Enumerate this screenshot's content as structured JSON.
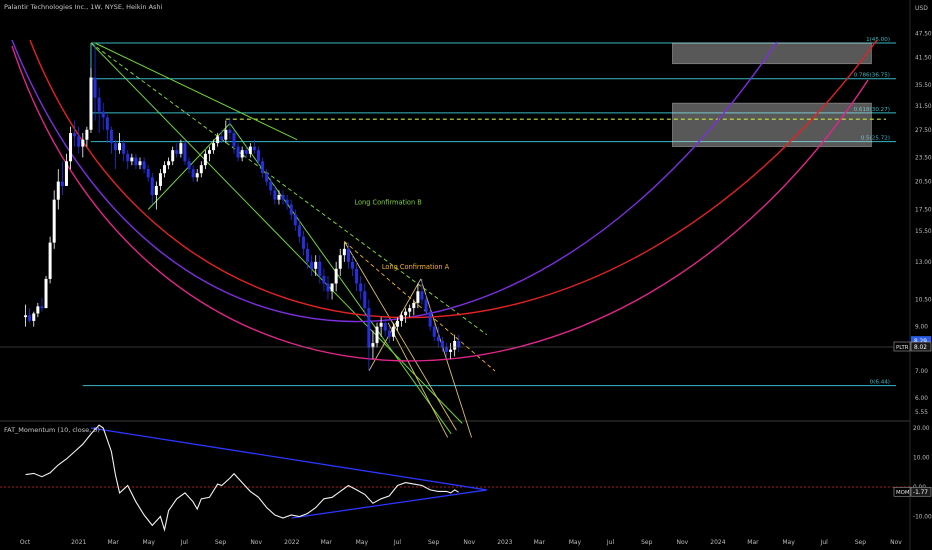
{
  "header": {
    "symbol_line": "Palantir Technologies Inc., 1W, NYSE, Heikin Ashi",
    "currency": "USD"
  },
  "indicator": {
    "title": "FAT_Momentum (10, close, 0)",
    "tag": "MOM",
    "value": "-1.77"
  },
  "price_tag": {
    "symbol": "PLTR",
    "value": "8.02",
    "prev_value": "8.29"
  },
  "chart_data": {
    "type": "candlestick",
    "y_scale": "log",
    "y_ticks": [
      "47.50",
      "41.50",
      "35.50",
      "31.50",
      "27.50",
      "23.50",
      "20.50",
      "17.50",
      "15.50",
      "13.00",
      "10.50",
      "9.00",
      "7.00",
      "6.00",
      "5.55"
    ],
    "indicator_ticks": [
      "20.00",
      "10.00",
      "0.00",
      "-10.00"
    ],
    "x_ticks": [
      {
        "label": "Oct",
        "date": "2020-10-01"
      },
      {
        "label": "2021",
        "date": "2021-01-01"
      },
      {
        "label": "Mar",
        "date": "2021-03-01"
      },
      {
        "label": "May",
        "date": "2021-05-01"
      },
      {
        "label": "Jul",
        "date": "2021-07-01"
      },
      {
        "label": "Sep",
        "date": "2021-09-01"
      },
      {
        "label": "Nov",
        "date": "2021-11-01"
      },
      {
        "label": "2022",
        "date": "2022-01-01"
      },
      {
        "label": "Mar",
        "date": "2022-03-01"
      },
      {
        "label": "May",
        "date": "2022-05-01"
      },
      {
        "label": "Jul",
        "date": "2022-07-01"
      },
      {
        "label": "Sep",
        "date": "2022-09-01"
      },
      {
        "label": "Nov",
        "date": "2022-11-01"
      },
      {
        "label": "2023",
        "date": "2023-01-01"
      },
      {
        "label": "Mar",
        "date": "2023-03-01"
      },
      {
        "label": "May",
        "date": "2023-05-01"
      },
      {
        "label": "Jul",
        "date": "2023-07-01"
      },
      {
        "label": "Sep",
        "date": "2023-09-01"
      },
      {
        "label": "Nov",
        "date": "2023-11-01"
      },
      {
        "label": "2024",
        "date": "2024-01-01"
      },
      {
        "label": "Mar",
        "date": "2024-03-01"
      },
      {
        "label": "May",
        "date": "2024-05-01"
      },
      {
        "label": "Jul",
        "date": "2024-07-01"
      },
      {
        "label": "Sep",
        "date": "2024-09-01"
      },
      {
        "label": "Nov",
        "date": "2024-11-01"
      }
    ],
    "fib_levels": [
      {
        "label": "1(45.00)",
        "value": 45.0
      },
      {
        "label": "0.786(36.75)",
        "value": 36.75
      },
      {
        "label": "0.618(30.27)",
        "value": 30.27
      },
      {
        "label": "0.5(25.72)",
        "value": 25.72
      },
      {
        "label": "0(6.44)",
        "value": 6.44
      }
    ],
    "annotations": [
      {
        "text": "Long Confirmation B",
        "date": "2022-06-15",
        "price": 18.0,
        "color": "#7cd234"
      },
      {
        "text": "Long Confirmation A",
        "date": "2022-08-01",
        "price": 12.5,
        "color": "#f5b323"
      }
    ],
    "zones": [
      {
        "date_from": "2023-10-15",
        "date_to": "2024-09-20",
        "price_from": 40.0,
        "price_to": 45.0
      },
      {
        "date_from": "2023-10-15",
        "date_to": "2024-09-20",
        "price_from": 25.0,
        "price_to": 32.0
      }
    ],
    "candles": [
      [
        "2020-10-02",
        9.5,
        10.2,
        9.0,
        9.6
      ],
      [
        "2020-10-09",
        9.6,
        10.0,
        9.2,
        9.3
      ],
      [
        "2020-10-16",
        9.3,
        9.8,
        9.0,
        9.7
      ],
      [
        "2020-10-23",
        9.7,
        10.3,
        9.5,
        10.1
      ],
      [
        "2020-10-30",
        10.1,
        10.6,
        9.8,
        10.0
      ],
      [
        "2020-11-06",
        10.0,
        12.0,
        10.0,
        11.8
      ],
      [
        "2020-11-13",
        11.8,
        15.0,
        11.5,
        14.5
      ],
      [
        "2020-11-20",
        14.5,
        19.5,
        14.0,
        18.5
      ],
      [
        "2020-11-27",
        18.5,
        22.0,
        17.5,
        20.5
      ],
      [
        "2020-12-04",
        20.5,
        23.0,
        19.0,
        20.0
      ],
      [
        "2020-12-11",
        20.0,
        24.0,
        20.0,
        23.0
      ],
      [
        "2020-12-18",
        23.0,
        28.0,
        22.0,
        27.0
      ],
      [
        "2020-12-25",
        27.0,
        29.0,
        25.0,
        26.5
      ],
      [
        "2021-01-01",
        26.5,
        28.0,
        24.0,
        25.0
      ],
      [
        "2021-01-08",
        25.0,
        27.0,
        23.5,
        26.0
      ],
      [
        "2021-01-15",
        26.0,
        28.0,
        25.0,
        27.5
      ],
      [
        "2021-01-22",
        27.5,
        39.0,
        27.0,
        37.0
      ],
      [
        "2021-01-29",
        37.0,
        45.0,
        29.0,
        33.0
      ],
      [
        "2021-02-05",
        33.0,
        35.0,
        27.0,
        30.5
      ],
      [
        "2021-02-12",
        30.5,
        32.0,
        27.5,
        29.5
      ],
      [
        "2021-02-19",
        29.5,
        30.0,
        25.5,
        27.5
      ],
      [
        "2021-02-26",
        27.5,
        28.0,
        24.0,
        25.5
      ],
      [
        "2021-03-05",
        25.5,
        26.0,
        22.0,
        24.5
      ],
      [
        "2021-03-12",
        24.5,
        27.0,
        24.0,
        25.5
      ],
      [
        "2021-03-19",
        25.5,
        26.0,
        23.0,
        24.0
      ],
      [
        "2021-03-26",
        24.0,
        24.5,
        22.0,
        23.0
      ],
      [
        "2021-04-02",
        23.0,
        24.0,
        22.5,
        23.5
      ],
      [
        "2021-04-09",
        23.5,
        24.0,
        22.0,
        22.5
      ],
      [
        "2021-04-16",
        22.5,
        23.5,
        22.0,
        23.0
      ],
      [
        "2021-04-23",
        23.0,
        23.5,
        21.5,
        22.0
      ],
      [
        "2021-04-30",
        22.0,
        22.5,
        20.5,
        21.0
      ],
      [
        "2021-05-07",
        21.0,
        21.5,
        18.0,
        19.0
      ],
      [
        "2021-05-14",
        19.0,
        20.5,
        17.5,
        20.0
      ],
      [
        "2021-05-21",
        20.0,
        22.0,
        19.5,
        21.5
      ],
      [
        "2021-05-28",
        21.5,
        23.0,
        21.0,
        22.5
      ],
      [
        "2021-06-04",
        22.5,
        23.5,
        22.0,
        23.0
      ],
      [
        "2021-06-11",
        23.0,
        25.0,
        22.5,
        24.5
      ],
      [
        "2021-06-18",
        24.5,
        25.5,
        23.5,
        24.0
      ],
      [
        "2021-06-25",
        24.0,
        26.0,
        23.5,
        25.5
      ],
      [
        "2021-07-02",
        25.5,
        26.0,
        22.5,
        23.0
      ],
      [
        "2021-07-09",
        23.0,
        23.5,
        21.5,
        22.0
      ],
      [
        "2021-07-16",
        22.0,
        22.5,
        20.5,
        21.0
      ],
      [
        "2021-07-23",
        21.0,
        22.0,
        20.5,
        21.5
      ],
      [
        "2021-07-30",
        21.5,
        23.0,
        21.0,
        22.5
      ],
      [
        "2021-08-06",
        22.5,
        24.5,
        22.0,
        24.0
      ],
      [
        "2021-08-13",
        24.0,
        25.0,
        23.0,
        24.5
      ],
      [
        "2021-08-20",
        24.5,
        26.0,
        24.0,
        25.5
      ],
      [
        "2021-08-27",
        25.5,
        27.0,
        25.0,
        26.5
      ],
      [
        "2021-09-03",
        26.5,
        27.5,
        25.5,
        26.0
      ],
      [
        "2021-09-10",
        26.0,
        29.0,
        25.5,
        27.5
      ],
      [
        "2021-09-17",
        27.5,
        29.5,
        26.0,
        27.0
      ],
      [
        "2021-09-24",
        27.0,
        27.5,
        24.0,
        25.0
      ],
      [
        "2021-10-01",
        25.0,
        25.5,
        23.0,
        23.5
      ],
      [
        "2021-10-08",
        23.5,
        25.0,
        23.0,
        24.5
      ],
      [
        "2021-10-15",
        24.5,
        25.0,
        23.5,
        24.0
      ],
      [
        "2021-10-22",
        24.0,
        25.5,
        23.5,
        25.0
      ],
      [
        "2021-10-29",
        25.0,
        26.0,
        24.0,
        24.5
      ],
      [
        "2021-11-05",
        24.5,
        25.0,
        22.5,
        23.0
      ],
      [
        "2021-11-12",
        23.0,
        23.5,
        21.0,
        21.5
      ],
      [
        "2021-11-19",
        21.5,
        22.0,
        20.0,
        20.5
      ],
      [
        "2021-11-26",
        20.5,
        21.0,
        19.0,
        19.5
      ],
      [
        "2021-12-03",
        19.5,
        20.0,
        18.0,
        18.5
      ],
      [
        "2021-12-10",
        18.5,
        19.5,
        18.0,
        19.0
      ],
      [
        "2021-12-17",
        19.0,
        19.5,
        18.0,
        18.5
      ],
      [
        "2021-12-24",
        18.5,
        19.0,
        17.5,
        18.0
      ],
      [
        "2021-12-31",
        18.0,
        18.5,
        16.5,
        17.0
      ],
      [
        "2022-01-07",
        17.0,
        17.5,
        15.5,
        16.0
      ],
      [
        "2022-01-14",
        16.0,
        16.5,
        14.5,
        15.0
      ],
      [
        "2022-01-21",
        15.0,
        15.5,
        13.5,
        14.0
      ],
      [
        "2022-01-28",
        14.0,
        14.5,
        12.5,
        13.0
      ],
      [
        "2022-02-04",
        13.0,
        13.5,
        12.0,
        12.5
      ],
      [
        "2022-02-11",
        12.5,
        13.5,
        12.0,
        13.0
      ],
      [
        "2022-02-18",
        13.0,
        13.5,
        11.5,
        12.0
      ],
      [
        "2022-02-25",
        12.0,
        12.5,
        11.0,
        11.5
      ],
      [
        "2022-03-04",
        11.5,
        12.0,
        10.5,
        11.0
      ],
      [
        "2022-03-11",
        11.0,
        11.5,
        10.5,
        11.5
      ],
      [
        "2022-03-18",
        11.5,
        13.0,
        11.0,
        12.5
      ],
      [
        "2022-03-25",
        12.5,
        14.0,
        12.0,
        13.5
      ],
      [
        "2022-04-01",
        13.5,
        14.5,
        13.0,
        14.0
      ],
      [
        "2022-04-08",
        14.0,
        14.5,
        12.5,
        13.0
      ],
      [
        "2022-04-15",
        13.0,
        13.5,
        12.0,
        12.5
      ],
      [
        "2022-04-22",
        12.5,
        13.0,
        11.0,
        11.5
      ],
      [
        "2022-04-29",
        11.5,
        12.0,
        10.5,
        11.0
      ],
      [
        "2022-05-06",
        11.0,
        11.5,
        9.5,
        10.0
      ],
      [
        "2022-05-13",
        10.0,
        10.5,
        7.0,
        8.0
      ],
      [
        "2022-05-20",
        8.0,
        8.8,
        7.5,
        8.2
      ],
      [
        "2022-05-27",
        8.2,
        9.2,
        8.0,
        9.0
      ],
      [
        "2022-06-03",
        9.0,
        9.5,
        8.5,
        9.2
      ],
      [
        "2022-06-10",
        9.2,
        9.5,
        8.5,
        8.8
      ],
      [
        "2022-06-17",
        8.8,
        9.0,
        8.2,
        8.5
      ],
      [
        "2022-06-24",
        8.5,
        9.2,
        8.3,
        9.0
      ],
      [
        "2022-07-01",
        9.0,
        9.5,
        8.8,
        9.3
      ],
      [
        "2022-07-08",
        9.3,
        9.8,
        9.0,
        9.6
      ],
      [
        "2022-07-15",
        9.6,
        10.0,
        9.2,
        9.8
      ],
      [
        "2022-07-22",
        9.8,
        10.2,
        9.5,
        10.0
      ],
      [
        "2022-07-29",
        10.0,
        10.5,
        9.6,
        10.3
      ],
      [
        "2022-08-05",
        10.3,
        11.5,
        10.0,
        11.0
      ],
      [
        "2022-08-12",
        11.0,
        11.8,
        10.2,
        10.5
      ],
      [
        "2022-08-19",
        10.5,
        10.8,
        9.5,
        9.8
      ],
      [
        "2022-08-26",
        9.8,
        10.0,
        8.8,
        9.0
      ],
      [
        "2022-09-02",
        9.0,
        9.2,
        8.3,
        8.5
      ],
      [
        "2022-09-09",
        8.5,
        9.0,
        8.0,
        8.3
      ],
      [
        "2022-09-16",
        8.3,
        8.5,
        7.8,
        8.0
      ],
      [
        "2022-09-23",
        8.0,
        8.2,
        7.6,
        7.8
      ],
      [
        "2022-09-30",
        7.8,
        8.2,
        7.5,
        7.9
      ],
      [
        "2022-10-07",
        7.9,
        8.6,
        7.6,
        8.3
      ],
      [
        "2022-10-14",
        8.3,
        8.6,
        7.8,
        8.02
      ]
    ],
    "momentum": [
      [
        "2020-10-02",
        4.2
      ],
      [
        "2020-10-16",
        4.6
      ],
      [
        "2020-10-30",
        3.5
      ],
      [
        "2020-11-13",
        4.8
      ],
      [
        "2020-11-27",
        7.5
      ],
      [
        "2020-12-11",
        9.5
      ],
      [
        "2020-12-25",
        12.0
      ],
      [
        "2021-01-08",
        14.5
      ],
      [
        "2021-01-22",
        18.0
      ],
      [
        "2021-02-05",
        21.0
      ],
      [
        "2021-02-12",
        20.0
      ],
      [
        "2021-02-26",
        12.0
      ],
      [
        "2021-03-05",
        4.0
      ],
      [
        "2021-03-12",
        -2.0
      ],
      [
        "2021-03-26",
        0.5
      ],
      [
        "2021-04-09",
        -5.0
      ],
      [
        "2021-04-23",
        -9.5
      ],
      [
        "2021-05-07",
        -13.0
      ],
      [
        "2021-05-21",
        -10.0
      ],
      [
        "2021-05-28",
        -14.5
      ],
      [
        "2021-06-04",
        -8.0
      ],
      [
        "2021-06-18",
        -4.0
      ],
      [
        "2021-07-02",
        -2.0
      ],
      [
        "2021-07-16",
        -5.0
      ],
      [
        "2021-07-23",
        -7.5
      ],
      [
        "2021-07-30",
        -4.0
      ],
      [
        "2021-08-13",
        -3.5
      ],
      [
        "2021-08-27",
        1.0
      ],
      [
        "2021-09-03",
        0.5
      ],
      [
        "2021-09-17",
        3.0
      ],
      [
        "2021-09-24",
        4.5
      ],
      [
        "2021-10-08",
        1.5
      ],
      [
        "2021-10-22",
        -1.5
      ],
      [
        "2021-11-05",
        -3.5
      ],
      [
        "2021-11-19",
        -7.0
      ],
      [
        "2021-12-03",
        -9.5
      ],
      [
        "2021-12-17",
        -10.5
      ],
      [
        "2021-12-31",
        -9.5
      ],
      [
        "2022-01-14",
        -10.0
      ],
      [
        "2022-01-28",
        -9.0
      ],
      [
        "2022-02-11",
        -7.0
      ],
      [
        "2022-02-25",
        -4.0
      ],
      [
        "2022-03-11",
        -3.5
      ],
      [
        "2022-03-25",
        -1.5
      ],
      [
        "2022-04-08",
        0.5
      ],
      [
        "2022-04-22",
        -1.0
      ],
      [
        "2022-05-06",
        -2.5
      ],
      [
        "2022-05-20",
        -5.5
      ],
      [
        "2022-06-03",
        -4.0
      ],
      [
        "2022-06-17",
        -3.0
      ],
      [
        "2022-07-01",
        0.5
      ],
      [
        "2022-07-15",
        1.5
      ],
      [
        "2022-07-29",
        1.0
      ],
      [
        "2022-08-12",
        0.5
      ],
      [
        "2022-08-26",
        -1.0
      ],
      [
        "2022-09-09",
        -1.5
      ],
      [
        "2022-09-23",
        -1.5
      ],
      [
        "2022-09-30",
        -2.0
      ],
      [
        "2022-10-07",
        -1.0
      ],
      [
        "2022-10-14",
        -1.77
      ]
    ]
  }
}
